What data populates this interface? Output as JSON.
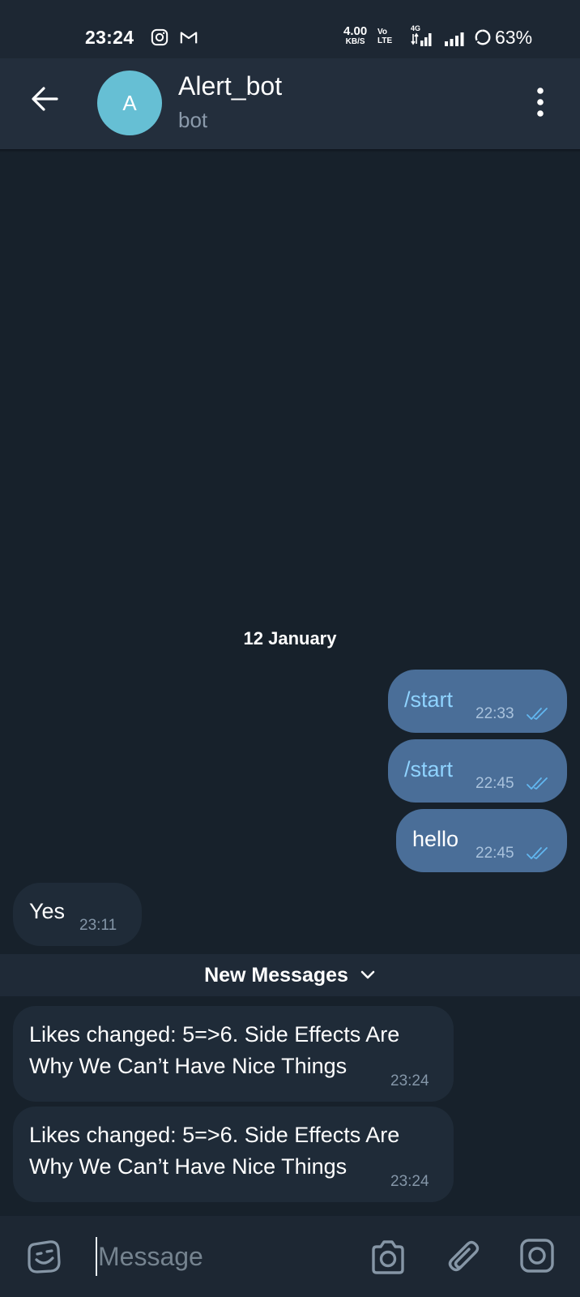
{
  "status_bar": {
    "time": "23:24",
    "net_speed": "4.00",
    "net_unit": "KB/S",
    "volte_top": "Vo",
    "volte_bottom": "LTE",
    "network_type": "4G",
    "battery": "63%",
    "icons": [
      "instagram-icon",
      "gmail-icon",
      "signal-icon",
      "battery-icon"
    ]
  },
  "header": {
    "back_icon": "arrow-left-icon",
    "avatar_letter": "A",
    "avatar_color": "#66bfd4",
    "title": "Alert_bot",
    "subtitle": "bot",
    "menu_icon": "more-vertical-icon"
  },
  "chat": {
    "date_label": "12 January",
    "outgoing": [
      {
        "text": "/start",
        "time": "22:33",
        "status": "read"
      },
      {
        "text": "/start",
        "time": "22:45",
        "status": "read"
      },
      {
        "text": "hello",
        "time": "22:45",
        "status": "read"
      }
    ],
    "incoming_before": [
      {
        "text": "Yes",
        "time": "23:11"
      }
    ],
    "new_messages_label": "New Messages",
    "incoming_after": [
      {
        "line1": "Likes changed: 5=>6. Side Effects Are",
        "line2": "Why We Can’t Have Nice Things",
        "time": "23:24"
      },
      {
        "line1": "Likes changed: 5=>6. Side Effects Are",
        "line2": "Why We Can’t Have Nice Things",
        "time": "23:24"
      }
    ]
  },
  "input_bar": {
    "placeholder": "Message",
    "value": "",
    "icons": [
      "emoji-icon",
      "camera-icon",
      "paperclip-icon",
      "video-message-icon"
    ]
  },
  "colors": {
    "background": "#17212b",
    "header": "#232e3c",
    "outgoing_bubble": "#4a6e98",
    "incoming_bubble": "#1f2b38",
    "command_link": "#8fd3ff",
    "read_ticks": "#62b7f0"
  }
}
